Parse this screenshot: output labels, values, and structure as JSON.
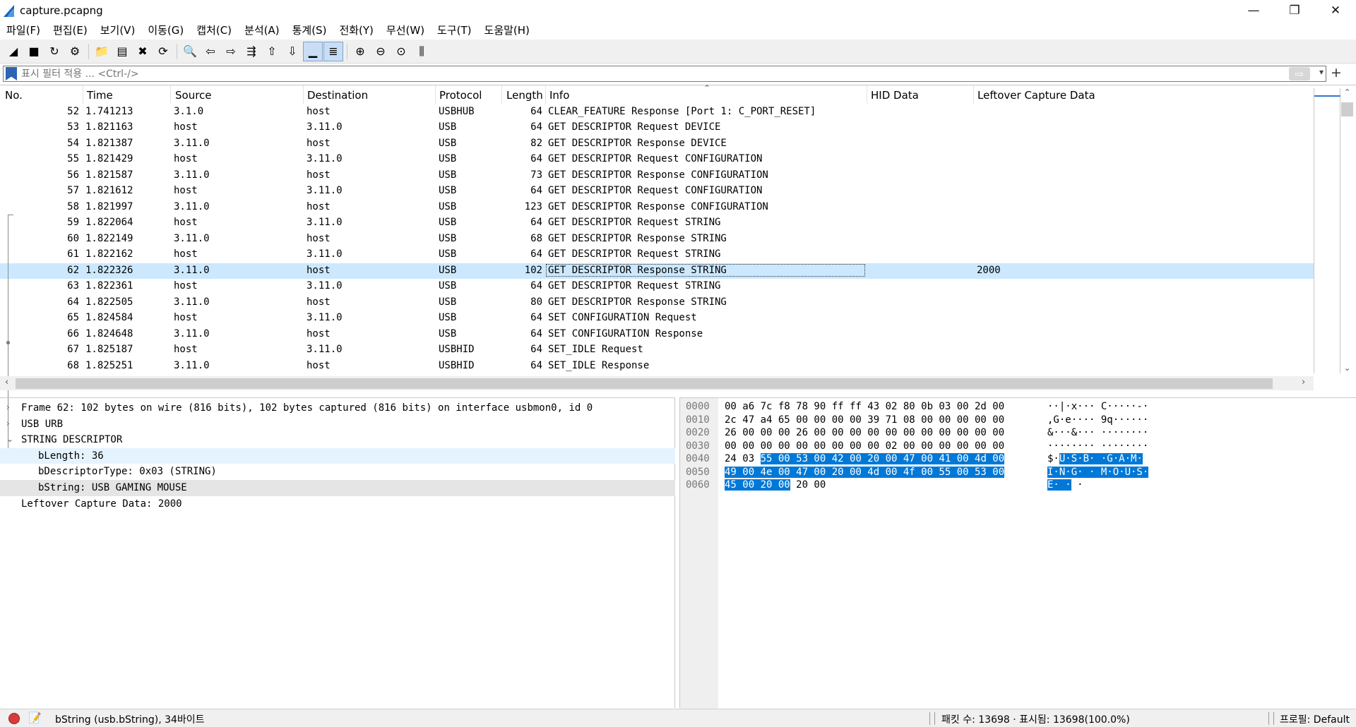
{
  "window": {
    "title": "capture.pcapng",
    "minimize": "—",
    "restore": "❐",
    "close": "✕"
  },
  "menu": [
    "파일(F)",
    "편집(E)",
    "보기(V)",
    "이동(G)",
    "캡처(C)",
    "분석(A)",
    "통계(S)",
    "전화(Y)",
    "무선(W)",
    "도구(T)",
    "도움말(H)"
  ],
  "toolbar": [
    {
      "icon": "shark-start-icon",
      "glyph": "◢"
    },
    {
      "icon": "stop-icon",
      "glyph": "■"
    },
    {
      "icon": "restart-icon",
      "glyph": "↻"
    },
    {
      "icon": "options-icon",
      "glyph": "⚙"
    },
    {
      "sep": true
    },
    {
      "icon": "open-icon",
      "glyph": "📁"
    },
    {
      "icon": "save-icon",
      "glyph": "▤"
    },
    {
      "icon": "close-file-icon",
      "glyph": "✖"
    },
    {
      "icon": "reload-icon",
      "glyph": "⟳"
    },
    {
      "sep": true
    },
    {
      "icon": "find-icon",
      "glyph": "🔍"
    },
    {
      "icon": "back-icon",
      "glyph": "⇦"
    },
    {
      "icon": "forward-icon",
      "glyph": "⇨"
    },
    {
      "icon": "go-to-packet-icon",
      "glyph": "⇶"
    },
    {
      "icon": "first-packet-icon",
      "glyph": "⇧"
    },
    {
      "icon": "last-packet-icon",
      "glyph": "⇩"
    },
    {
      "icon": "autoscroll-icon",
      "glyph": "▁",
      "active": true
    },
    {
      "icon": "colorize-icon",
      "glyph": "≣",
      "active": true
    },
    {
      "sep": true
    },
    {
      "icon": "zoom-in-icon",
      "glyph": "⊕"
    },
    {
      "icon": "zoom-out-icon",
      "glyph": "⊖"
    },
    {
      "icon": "zoom-normal-icon",
      "glyph": "⊙"
    },
    {
      "icon": "resize-columns-icon",
      "glyph": "⫼"
    }
  ],
  "filter": {
    "placeholder": "표시 필터 적용 ... <Ctrl-/>",
    "apply": "⇨",
    "dropdown": "▾",
    "add": "+"
  },
  "columns": [
    "No.",
    "Time",
    "Source",
    "Destination",
    "Protocol",
    "Length",
    "Info",
    "HID Data",
    "Leftover Capture Data"
  ],
  "packets": [
    {
      "no": "52",
      "time": "1.741213",
      "src": "3.1.0",
      "dst": "host",
      "proto": "USBHUB",
      "len": "64",
      "info": "CLEAR_FEATURE Response [Port 1: C_PORT_RESET]",
      "hid": "",
      "left": ""
    },
    {
      "no": "53",
      "time": "1.821163",
      "src": "host",
      "dst": "3.11.0",
      "proto": "USB",
      "len": "64",
      "info": "GET DESCRIPTOR Request DEVICE",
      "hid": "",
      "left": ""
    },
    {
      "no": "54",
      "time": "1.821387",
      "src": "3.11.0",
      "dst": "host",
      "proto": "USB",
      "len": "82",
      "info": "GET DESCRIPTOR Response DEVICE",
      "hid": "",
      "left": ""
    },
    {
      "no": "55",
      "time": "1.821429",
      "src": "host",
      "dst": "3.11.0",
      "proto": "USB",
      "len": "64",
      "info": "GET DESCRIPTOR Request CONFIGURATION",
      "hid": "",
      "left": ""
    },
    {
      "no": "56",
      "time": "1.821587",
      "src": "3.11.0",
      "dst": "host",
      "proto": "USB",
      "len": "73",
      "info": "GET DESCRIPTOR Response CONFIGURATION",
      "hid": "",
      "left": ""
    },
    {
      "no": "57",
      "time": "1.821612",
      "src": "host",
      "dst": "3.11.0",
      "proto": "USB",
      "len": "64",
      "info": "GET DESCRIPTOR Request CONFIGURATION",
      "hid": "",
      "left": ""
    },
    {
      "no": "58",
      "time": "1.821997",
      "src": "3.11.0",
      "dst": "host",
      "proto": "USB",
      "len": "123",
      "info": "GET DESCRIPTOR Response CONFIGURATION",
      "hid": "",
      "left": ""
    },
    {
      "no": "59",
      "time": "1.822064",
      "src": "host",
      "dst": "3.11.0",
      "proto": "USB",
      "len": "64",
      "info": "GET DESCRIPTOR Request STRING",
      "hid": "",
      "left": ""
    },
    {
      "no": "60",
      "time": "1.822149",
      "src": "3.11.0",
      "dst": "host",
      "proto": "USB",
      "len": "68",
      "info": "GET DESCRIPTOR Response STRING",
      "hid": "",
      "left": ""
    },
    {
      "no": "61",
      "time": "1.822162",
      "src": "host",
      "dst": "3.11.0",
      "proto": "USB",
      "len": "64",
      "info": "GET DESCRIPTOR Request STRING",
      "hid": "",
      "left": ""
    },
    {
      "no": "62",
      "time": "1.822326",
      "src": "3.11.0",
      "dst": "host",
      "proto": "USB",
      "len": "102",
      "info": "GET DESCRIPTOR Response STRING",
      "hid": "",
      "left": "2000",
      "selected": true
    },
    {
      "no": "63",
      "time": "1.822361",
      "src": "host",
      "dst": "3.11.0",
      "proto": "USB",
      "len": "64",
      "info": "GET DESCRIPTOR Request STRING",
      "hid": "",
      "left": ""
    },
    {
      "no": "64",
      "time": "1.822505",
      "src": "3.11.0",
      "dst": "host",
      "proto": "USB",
      "len": "80",
      "info": "GET DESCRIPTOR Response STRING",
      "hid": "",
      "left": ""
    },
    {
      "no": "65",
      "time": "1.824584",
      "src": "host",
      "dst": "3.11.0",
      "proto": "USB",
      "len": "64",
      "info": "SET CONFIGURATION Request",
      "hid": "",
      "left": ""
    },
    {
      "no": "66",
      "time": "1.824648",
      "src": "3.11.0",
      "dst": "host",
      "proto": "USB",
      "len": "64",
      "info": "SET CONFIGURATION Response",
      "hid": "",
      "left": ""
    },
    {
      "no": "67",
      "time": "1.825187",
      "src": "host",
      "dst": "3.11.0",
      "proto": "USBHID",
      "len": "64",
      "info": "SET_IDLE Request",
      "hid": "",
      "left": ""
    },
    {
      "no": "68",
      "time": "1.825251",
      "src": "3.11.0",
      "dst": "host",
      "proto": "USBHID",
      "len": "64",
      "info": "SET_IDLE Response",
      "hid": "",
      "left": ""
    }
  ],
  "details": [
    {
      "arrow": "›",
      "indent": 0,
      "text": "Frame 62: 102 bytes on wire (816 bits), 102 bytes captured (816 bits) on interface usbmon0, id 0"
    },
    {
      "arrow": "›",
      "indent": 0,
      "text": "USB URB"
    },
    {
      "arrow": "⌄",
      "indent": 0,
      "text": "STRING DESCRIPTOR"
    },
    {
      "arrow": "",
      "indent": 1,
      "text": "bLength: 36",
      "hl": "hl1"
    },
    {
      "arrow": "",
      "indent": 1,
      "text": "bDescriptorType: 0x03 (STRING)"
    },
    {
      "arrow": "",
      "indent": 1,
      "text": "bString: USB GAMING MOUSE",
      "hl": "hl2"
    },
    {
      "arrow": "",
      "indent": 0,
      "text": "Leftover Capture Data: 2000"
    }
  ],
  "bytes": [
    {
      "off": "0000",
      "hex_pre": "00 a6 7c f8 78 90 ff ff  43 02 80 0b 03 00 2d 00",
      "hex_hl": "",
      "hex_post": "",
      "asc_pre": "··|·x··· C·····-·",
      "asc_hl": "",
      "asc_post": ""
    },
    {
      "off": "0010",
      "hex_pre": "2c 47 a4 65 00 00 00 00  39 71 08 00 00 00 00 00",
      "hex_hl": "",
      "hex_post": "",
      "asc_pre": ",G·e···· 9q······",
      "asc_hl": "",
      "asc_post": ""
    },
    {
      "off": "0020",
      "hex_pre": "26 00 00 00 26 00 00 00  00 00 00 00 00 00 00 00",
      "hex_hl": "",
      "hex_post": "",
      "asc_pre": "&···&··· ········",
      "asc_hl": "",
      "asc_post": ""
    },
    {
      "off": "0030",
      "hex_pre": "00 00 00 00 00 00 00 00  00 02 00 00 00 00 00 00",
      "hex_hl": "",
      "hex_post": "",
      "asc_pre": "········ ········",
      "asc_hl": "",
      "asc_post": ""
    },
    {
      "off": "0040",
      "hex_pre": "24 03 ",
      "hex_hl": "55 00 53 00 42 00  20 00 47 00 41 00 4d 00",
      "hex_post": "",
      "asc_pre": "$·",
      "asc_hl": "U·S·B·  ·G·A·M·",
      "asc_post": ""
    },
    {
      "off": "0050",
      "hex_pre": "",
      "hex_hl": "49 00 4e 00 47 00 20 00  4d 00 4f 00 55 00 53 00",
      "hex_post": "",
      "asc_pre": "",
      "asc_hl": "I·N·G· · M·O·U·S·",
      "asc_post": ""
    },
    {
      "off": "0060",
      "hex_pre": "",
      "hex_hl": "45 00 20 00",
      "hex_post": " 20 00",
      "asc_pre": "",
      "asc_hl": "E· ·",
      "asc_post": " ·"
    }
  ],
  "status": {
    "field": "bString (usb.bString), 34바이트",
    "packets": "패킷 수: 13698 · 표시됨: 13698(100.0%)",
    "profile": "프로필: Default",
    "edit_glyph": "📝"
  },
  "colors": {
    "selected_row": "#cce8ff",
    "byte_highlight": "#0078d7",
    "accent": "#2d64b3"
  }
}
